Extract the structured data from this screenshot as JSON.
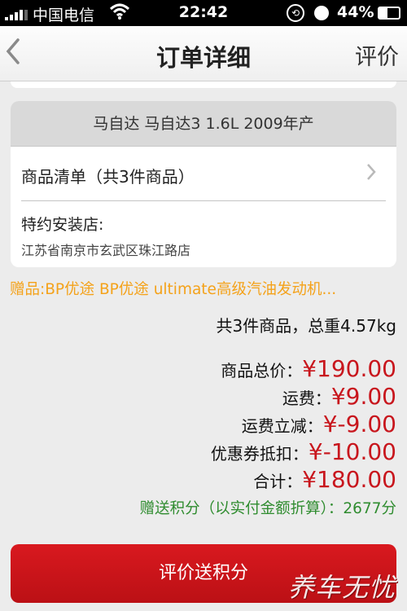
{
  "status_bar": {
    "carrier": "中国电信",
    "time": "22:42",
    "battery": "44%"
  },
  "nav": {
    "back_icon": "chevron-left-icon",
    "title": "订单详细",
    "rate_label": "评价"
  },
  "order_card": {
    "vehicle": "马自达 马自达3 1.6L 2009年产",
    "goods_label": "商品清单（共3件商品）",
    "store_label": "特约安装店:",
    "store_address": "江苏省南京市玄武区珠江路店"
  },
  "gift_text": "赠品:BP优途 BP优途 ultimate高级汽油发动机...",
  "summary": "共3件商品，总重4.57kg",
  "price_rows": [
    {
      "label": "商品总价",
      "amount": "¥190.00"
    },
    {
      "label": "运费",
      "amount": "¥9.00"
    },
    {
      "label": "运费立减",
      "amount": "¥-9.00"
    },
    {
      "label": "优惠券抵扣",
      "amount": "¥-10.00"
    },
    {
      "label": "合计",
      "amount": "¥180.00"
    }
  ],
  "points_text": "赠送积分（以实付金额折算）：2677分",
  "cta_label": "评价送积分",
  "watermark": "养车无忧",
  "colors": {
    "accent_red": "#c8161d",
    "gift_orange": "#f4a21a",
    "points_green": "#2f8c2f"
  }
}
